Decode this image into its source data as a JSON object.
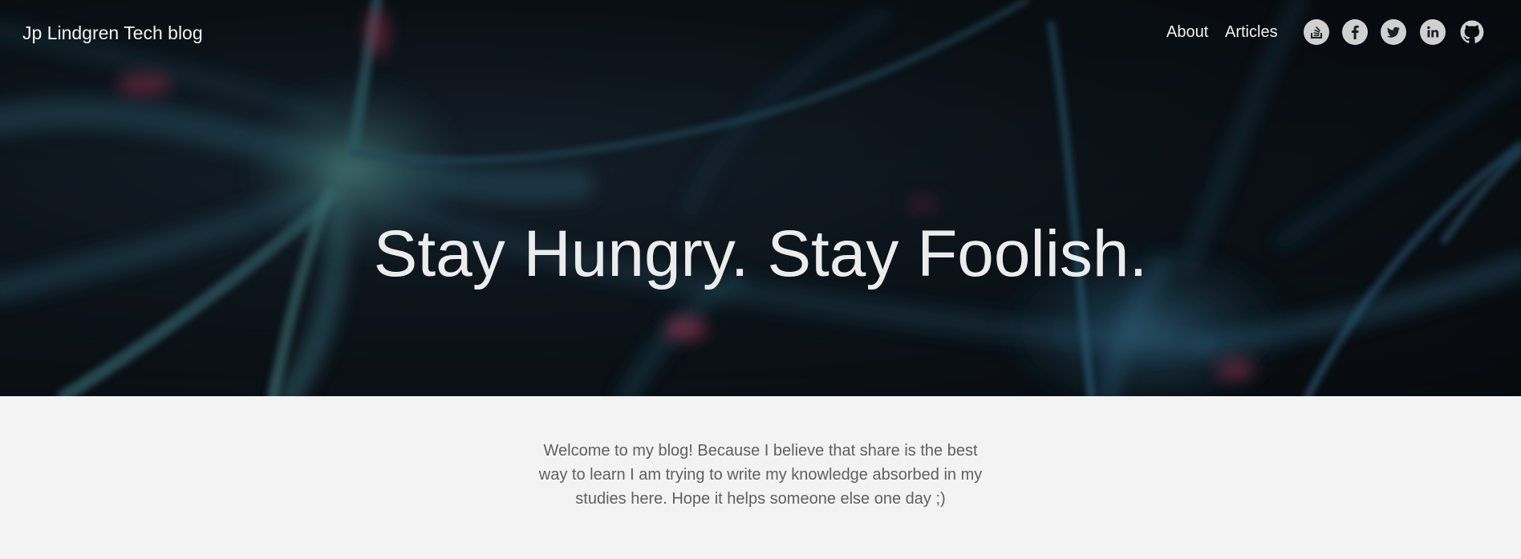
{
  "header": {
    "brand": "Jp Lindgren Tech blog",
    "nav": [
      {
        "label": "About"
      },
      {
        "label": "Articles"
      }
    ],
    "social_icons": [
      "stackoverflow-icon",
      "facebook-icon",
      "twitter-icon",
      "linkedin-icon",
      "github-icon"
    ]
  },
  "hero": {
    "headline": "Stay Hungry. Stay Foolish."
  },
  "main": {
    "intro": "Welcome to my blog! Because I believe that share is the best way to learn I am trying to write my knowledge absorbed in my studies here. Hope it helps someone else one day ;)"
  },
  "colors": {
    "hero_bg": "#0b1016",
    "page_bg": "#f3f3f3",
    "text_light": "#f2f2f2",
    "text_muted": "#606060",
    "icon_fill": "#d0d0d0",
    "neuron_teal": "#4f8e8a",
    "neuron_blue": "#2a6a8c",
    "neuron_pink": "#c9416b"
  }
}
